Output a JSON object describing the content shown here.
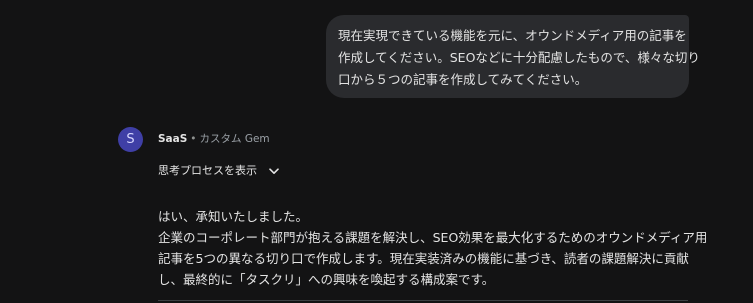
{
  "user_message": {
    "lines": [
      "現在実現できている機能を元に、オウンドメディア用の記事を",
      "作成してください。SEOなどに十分配慮したもので、様々な切り",
      "口から５つの記事を作成してみてください。"
    ]
  },
  "assistant": {
    "avatar_letter": "S",
    "name": "SaaS",
    "separator": "•",
    "gem_label": "カスタム Gem",
    "thinking_label": "思考プロセスを表示",
    "response_lines": [
      "はい、承知いたしました。",
      "企業のコーポレート部門が抱える課題を解決し、SEO効果を最大化するためのオウンドメディア用",
      "記事を5つの異なる切り口で作成します。現在実装済みの機能に基づき、読者の課題解決に貢献",
      "し、最終的に「タスクリ」への興味を喚起する構成案です。"
    ]
  },
  "colors": {
    "background": "#131314",
    "bubble": "#2a2b2e",
    "avatar": "#3f3fa6",
    "text": "#e3e3e3",
    "muted": "#9aa0a6"
  },
  "icons": {
    "thinking_toggle": "chevron-down-icon"
  }
}
